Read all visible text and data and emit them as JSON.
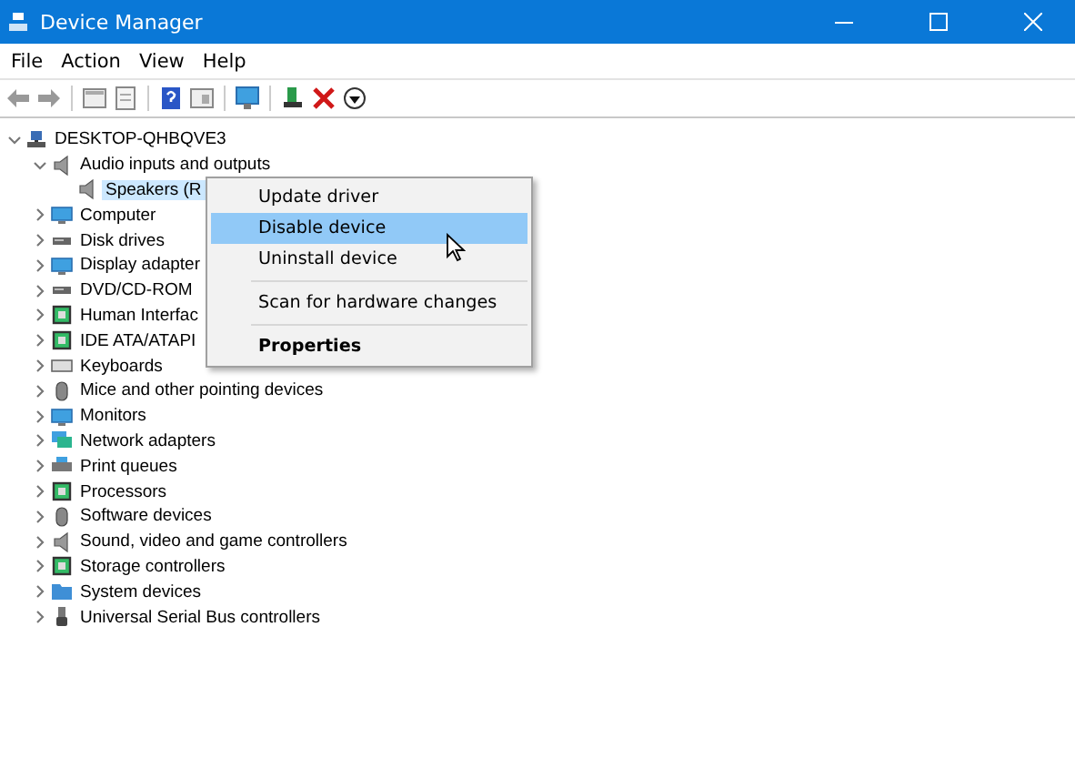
{
  "window": {
    "title": "Device Manager"
  },
  "menu_bar": [
    "File",
    "Action",
    "View",
    "Help"
  ],
  "tree": {
    "label": "DESKTOP-QHBQVE3",
    "kind": "computer",
    "expanded": true,
    "children": [
      {
        "label": "Audio inputs and outputs",
        "kind": "speaker",
        "expanded": true,
        "children": [
          {
            "label": "Speakers (R",
            "kind": "speaker",
            "selected": true
          }
        ]
      },
      {
        "label": "Computer",
        "kind": "monitor",
        "expanded": false
      },
      {
        "label": "Disk drives",
        "kind": "disk",
        "expanded": false
      },
      {
        "label": "Display adapter",
        "kind": "monitor",
        "expanded": false
      },
      {
        "label": "DVD/CD-ROM",
        "kind": "disk",
        "expanded": false
      },
      {
        "label": "Human Interfac",
        "kind": "chip",
        "expanded": false
      },
      {
        "label": "IDE ATA/ATAPI",
        "kind": "chip",
        "expanded": false
      },
      {
        "label": "Keyboards",
        "kind": "keyboard",
        "expanded": false
      },
      {
        "label": "Mice and other pointing devices",
        "kind": "mouse",
        "expanded": false
      },
      {
        "label": "Monitors",
        "kind": "monitor",
        "expanded": false
      },
      {
        "label": "Network adapters",
        "kind": "network",
        "expanded": false
      },
      {
        "label": "Print queues",
        "kind": "printer",
        "expanded": false
      },
      {
        "label": "Processors",
        "kind": "chip",
        "expanded": false
      },
      {
        "label": "Software devices",
        "kind": "mouse",
        "expanded": false
      },
      {
        "label": "Sound, video and game controllers",
        "kind": "speaker",
        "expanded": false
      },
      {
        "label": "Storage controllers",
        "kind": "chip",
        "expanded": false
      },
      {
        "label": "System devices",
        "kind": "folder",
        "expanded": false
      },
      {
        "label": "Universal Serial Bus controllers",
        "kind": "usb",
        "expanded": false
      }
    ]
  },
  "context_menu": [
    {
      "label": "Update driver",
      "kind": "item",
      "selected": false
    },
    {
      "label": "Disable device",
      "kind": "item",
      "selected": true
    },
    {
      "label": "Uninstall device",
      "kind": "item",
      "selected": false
    },
    {
      "kind": "separator"
    },
    {
      "label": "Scan for hardware changes",
      "kind": "item",
      "selected": false
    },
    {
      "kind": "separator"
    },
    {
      "label": "Properties",
      "kind": "default",
      "selected": false
    }
  ]
}
